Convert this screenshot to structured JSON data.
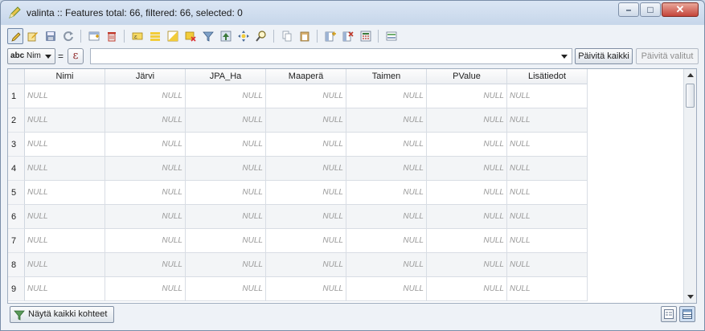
{
  "window": {
    "title": "valinta :: Features total: 66, filtered: 66, selected: 0",
    "controls": {
      "minimize": "–",
      "maximize": "□",
      "close": "✕"
    }
  },
  "toolbar": {
    "icons": [
      "toggle-editing-icon",
      "edit-multiple-icon",
      "save-edits-icon",
      "reload-icon",
      "add-feature-icon",
      "delete-feature-icon",
      "select-by-expression-icon",
      "select-all-icon",
      "invert-selection-icon",
      "deselect-all-icon",
      "filter-select-icon",
      "move-selection-top-icon",
      "pan-to-selected-icon",
      "zoom-to-selected-icon",
      "copy-rows-icon",
      "paste-features-icon",
      "new-field-icon",
      "delete-field-icon",
      "open-field-calculator-icon",
      "conditional-formatting-icon"
    ]
  },
  "expression_bar": {
    "field_prefix": "abc",
    "field_name": "Nim",
    "equals": "=",
    "epsilon": "ε",
    "expression_value": "",
    "update_all_label": "Päivitä kaikki",
    "update_selected_label": "Päivitä valitut"
  },
  "table": {
    "columns": [
      "Nimi",
      "Järvi",
      "JPA_Ha",
      "Maaperä",
      "Taimen",
      "PValue",
      "Lisätiedot"
    ],
    "null_text": "NULL",
    "rows": [
      "1",
      "2",
      "3",
      "4",
      "5",
      "6",
      "7",
      "8",
      "9"
    ]
  },
  "statusbar": {
    "filter_label": "Näytä kaikki kohteet"
  },
  "colors": {
    "title_gradient": "#c6d6ea",
    "close_button": "#c4443a",
    "table_alt_row": "#f3f5f7",
    "null_text": "#9a9a9a"
  }
}
